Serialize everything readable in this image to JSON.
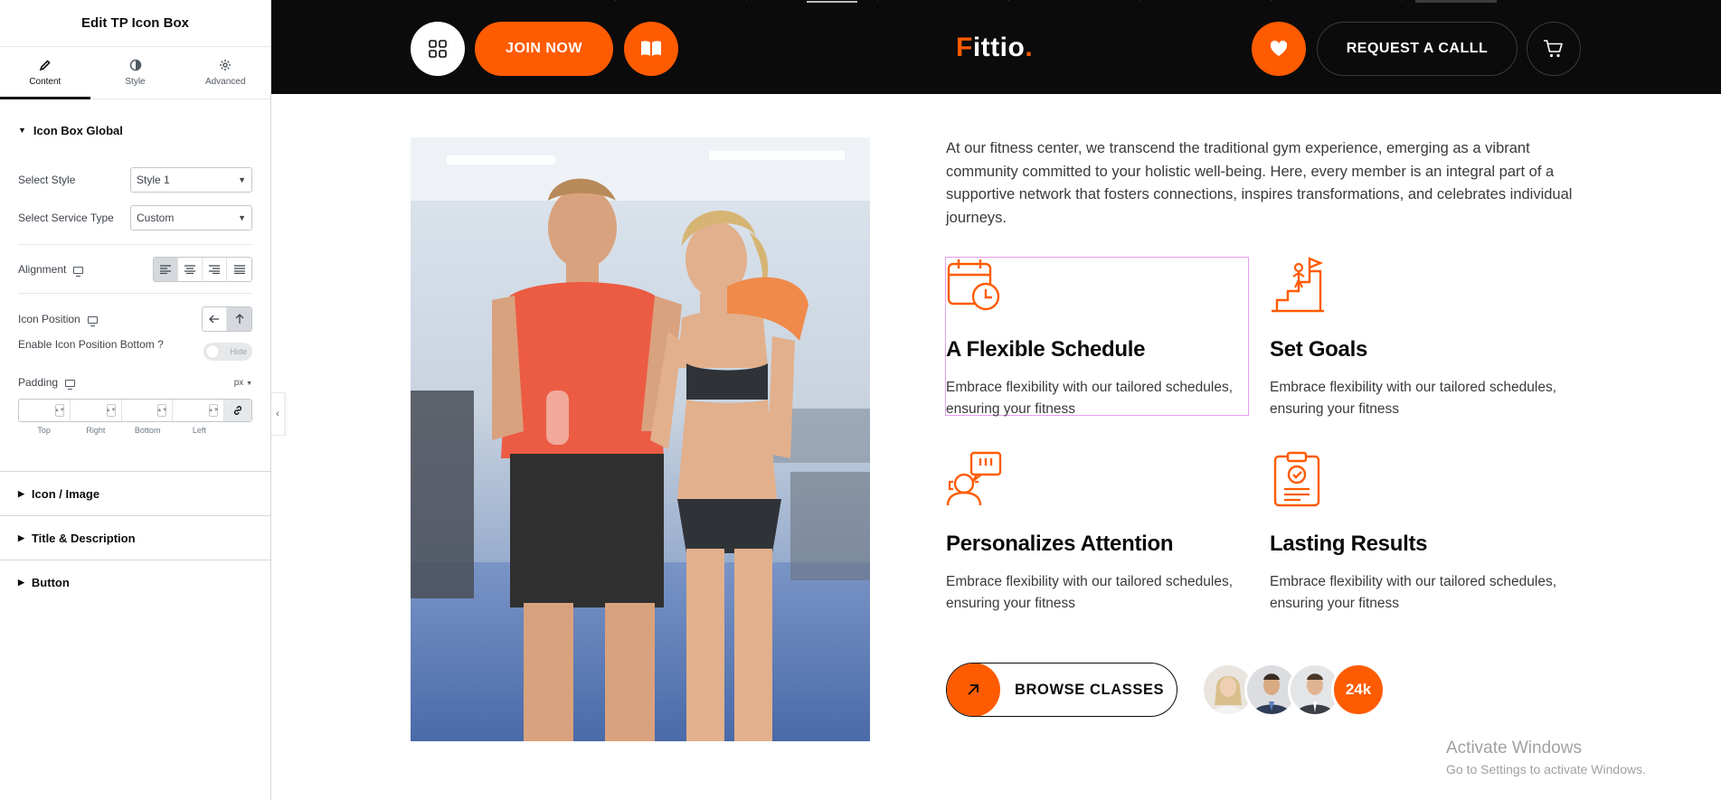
{
  "panel": {
    "title": "Edit TP Icon Box",
    "tabs": [
      {
        "label": "Content",
        "icon": "pencil-icon"
      },
      {
        "label": "Style",
        "icon": "half-circle-icon"
      },
      {
        "label": "Advanced",
        "icon": "gear-icon"
      }
    ],
    "section_open": "Icon Box Global",
    "select_style": {
      "label": "Select Style",
      "value": "Style 1"
    },
    "select_service_type": {
      "label": "Select Service Type",
      "value": "Custom"
    },
    "alignment": {
      "label": "Alignment",
      "selected": "left"
    },
    "icon_position": {
      "label": "Icon Position",
      "selected": "top"
    },
    "enable_icon_bottom": {
      "label": "Enable Icon Position Bottom ?",
      "toggle_text": "Hide"
    },
    "padding": {
      "label": "Padding",
      "unit": "px",
      "fields": [
        "Top",
        "Right",
        "Bottom",
        "Left"
      ]
    },
    "collapsed_sections": [
      "Icon / Image",
      "Title & Description",
      "Button"
    ]
  },
  "header": {
    "join_label": "JOIN NOW",
    "logo_letter": "F",
    "logo_rest": "ittio",
    "logo_dot": ".",
    "request_label": "REQUEST A CALLL",
    "colors": {
      "accent": "#ff5b00",
      "bg": "#0b0b0b"
    }
  },
  "main": {
    "intro": "At our fitness center, we transcend the traditional gym experience, emerging as a vibrant community committed to your holistic well-being. Here, every member is an integral part of a supportive network that fosters connections, inspires transformations, and celebrates individual journeys.",
    "features": [
      {
        "title": "A Flexible Schedule",
        "text": "Embrace flexibility with our tailored schedules, ensuring your fitness",
        "icon": "calendar-clock-icon"
      },
      {
        "title": "Set Goals",
        "text": "Embrace flexibility with our tailored schedules, ensuring your fitness",
        "icon": "goal-stairs-flag-icon"
      },
      {
        "title": "Personalizes Attention",
        "text": "Embrace flexibility with our tailored schedules, ensuring your fitness",
        "icon": "person-chat-icon"
      },
      {
        "title": "Lasting Results",
        "text": "Embrace flexibility with our tailored schedules, ensuring your fitness",
        "icon": "clipboard-check-icon"
      }
    ],
    "browse_label": "BROWSE CLASSES",
    "member_count": "24k"
  },
  "watermark": {
    "line1": "Activate Windows",
    "line2": "Go to Settings to activate Windows."
  }
}
